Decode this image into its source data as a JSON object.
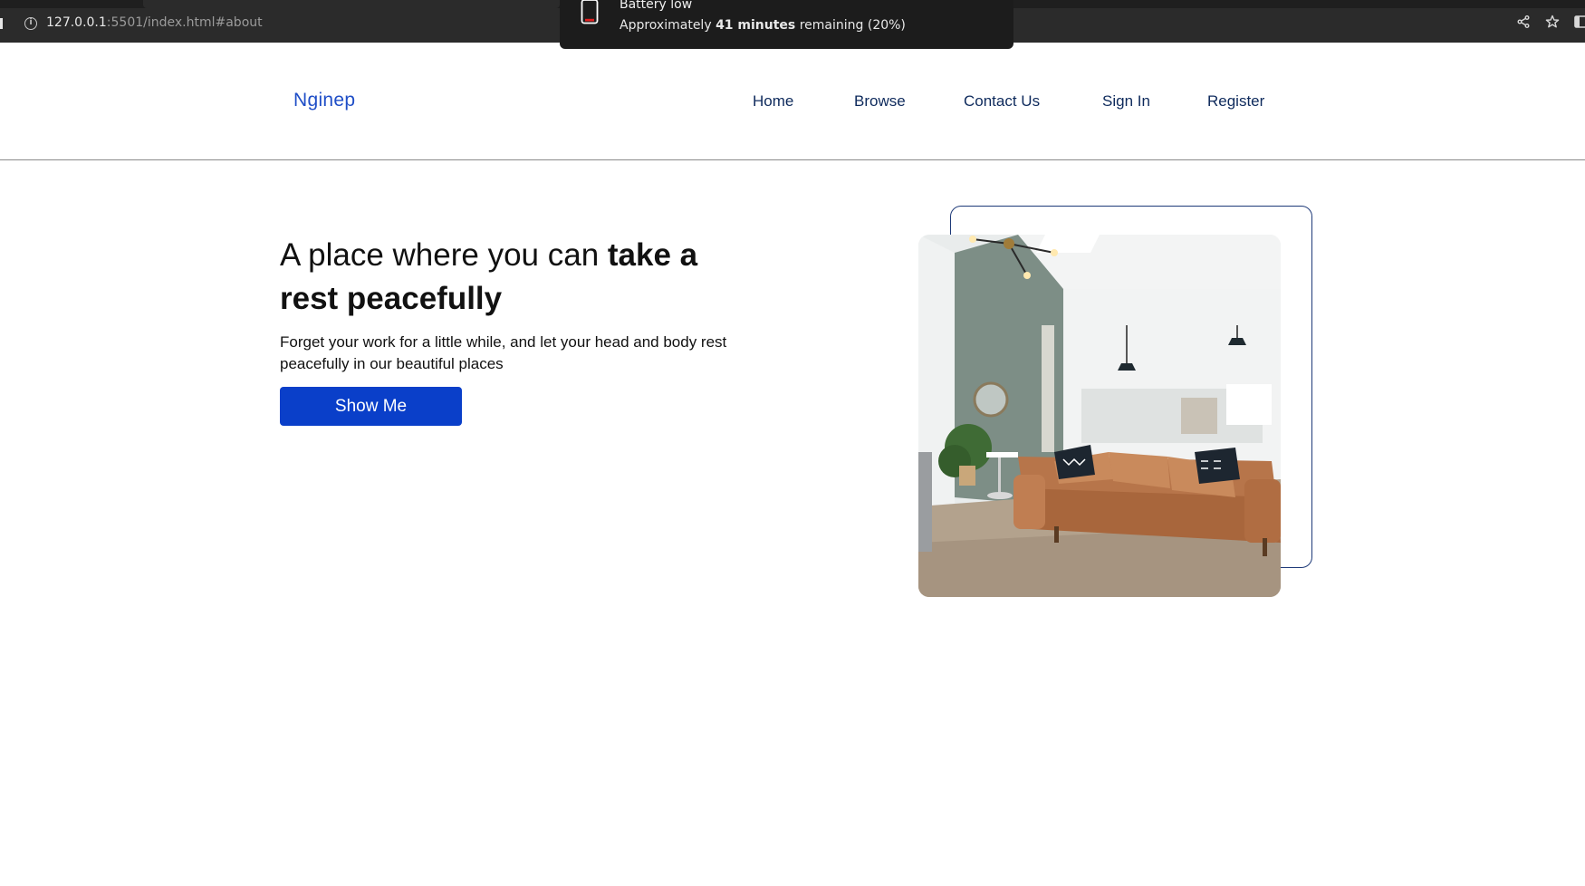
{
  "browser": {
    "url_host": "127.0.0.1",
    "url_path": ":5501/index.html#about",
    "icons": [
      "info-icon",
      "share-icon",
      "star-icon",
      "sidebar-icon"
    ]
  },
  "notification": {
    "title": "Battery low",
    "body_prefix": "Approximately ",
    "body_bold": "41 minutes",
    "body_suffix": " remaining (20%)",
    "icon": "battery-low-icon",
    "battery_level": 0.2
  },
  "site": {
    "logo": "Nginep",
    "nav": [
      "Home",
      "Browse",
      "Contact Us",
      "Sign In",
      "Register"
    ]
  },
  "hero": {
    "title_regular": "A place where you can ",
    "title_bold": "take a rest peacefully",
    "description": "Forget your work for a little while, and let your head and body rest peacefully in our beautiful places",
    "button_label": "Show Me",
    "image": "living-room-photo"
  },
  "colors": {
    "brand_blue": "#0a3fc9",
    "nav_text": "#0e2a5c",
    "logo": "#1f4ec7",
    "outline": "#1e3a78"
  }
}
